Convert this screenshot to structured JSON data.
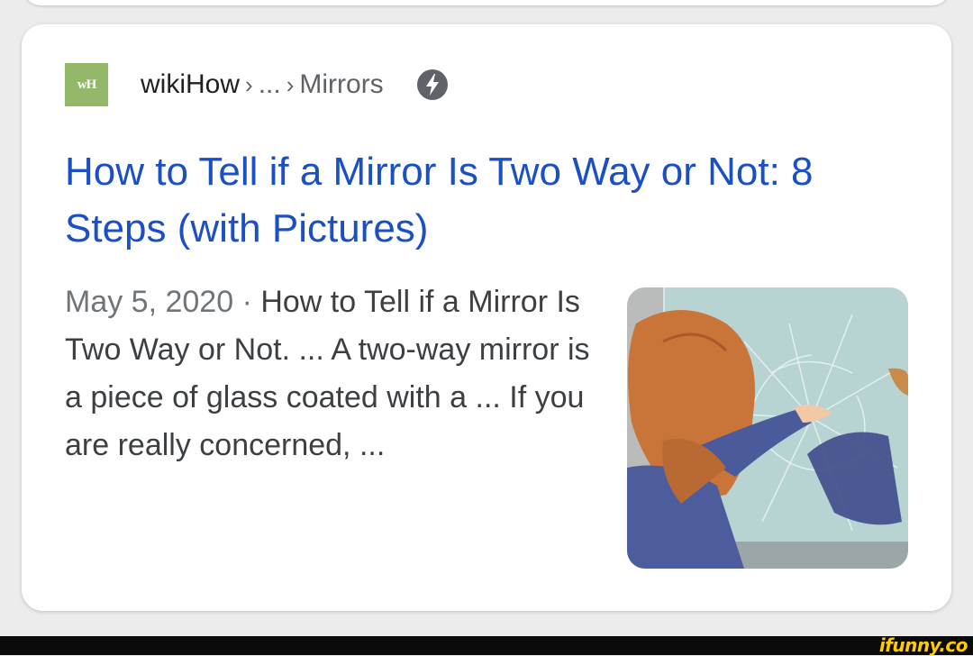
{
  "result": {
    "favicon_text": "wH",
    "site_name": "wikiHow",
    "breadcrumb_sep": "›",
    "breadcrumb_ellipsis": "...",
    "breadcrumb_last": "Mirrors",
    "amp_icon": "bolt-icon",
    "title": "How to Tell if a Mirror Is Two Way or Not: 8 Steps (with Pictures)",
    "date": "May 5, 2020",
    "date_sep": " · ",
    "snippet": "How to Tell if a Mirror Is Two Way or Not. ... A two-way mirror is a piece of glass coated with a ... If you are really concerned, ...",
    "thumbnail": "illustration of a woman touching a cracked mirror"
  },
  "watermark": {
    "text": "ifunny.co"
  },
  "colors": {
    "title": "#1b4fc4",
    "favicon_bg": "#93b869",
    "watermark": "#ffcc00"
  }
}
